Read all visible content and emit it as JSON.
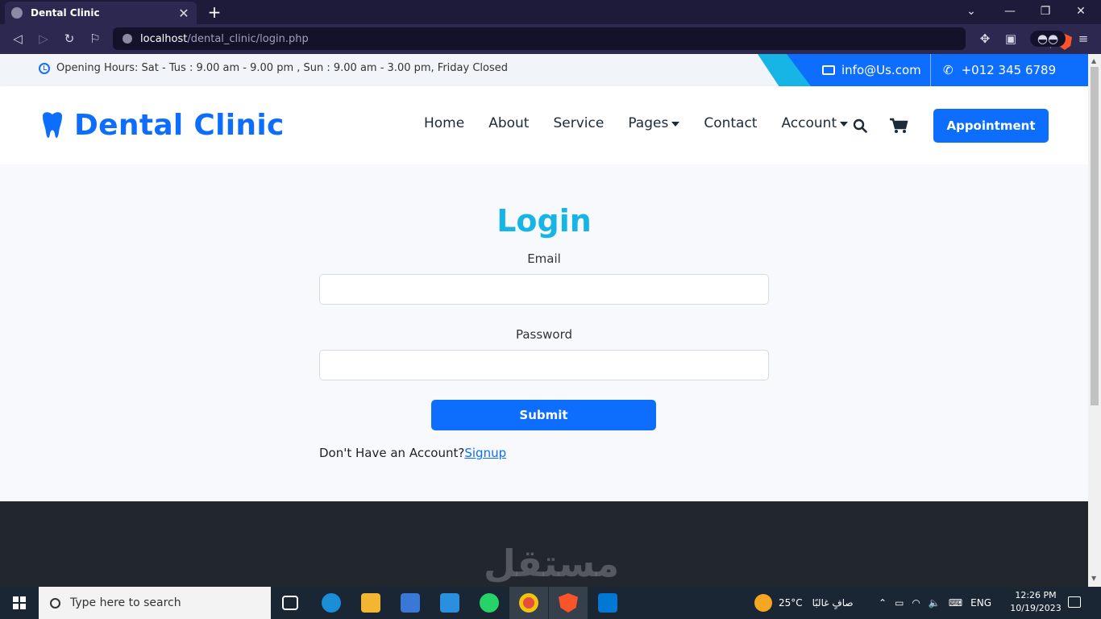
{
  "browser": {
    "tab_title": "Dental Clinic",
    "tab_close": "✕",
    "new_tab": "+",
    "url_host": "localhost",
    "url_path": "/dental_clinic/login.php"
  },
  "topbar": {
    "hours": "Opening Hours: Sat - Tus : 9.00 am - 9.00 pm , Sun : 9.00 am - 3.00 pm, Friday Closed",
    "email": "info@Us.com",
    "phone": "+012 345 6789"
  },
  "navbar": {
    "brand": "Dental Clinic",
    "links": [
      "Home",
      "About",
      "Service",
      "Pages",
      "Contact",
      "Account"
    ],
    "appointment_label": "Appointment"
  },
  "login": {
    "title": "Login",
    "email_label": "Email",
    "password_label": "Password",
    "submit_label": "Submit",
    "no_account_text": "Don't Have an Account?",
    "signup_link": "Signup"
  },
  "footer": {
    "watermark": "مستقل"
  },
  "taskbar": {
    "search_placeholder": "Type here to search",
    "weather_temp": "25°C",
    "weather_text": "صافٍ غالبًا",
    "language": "ENG",
    "time": "12:26 PM",
    "date": "10/19/2023"
  },
  "colors": {
    "primary": "#0d6efd",
    "accent": "#17b5e6",
    "footer": "#22272e"
  }
}
